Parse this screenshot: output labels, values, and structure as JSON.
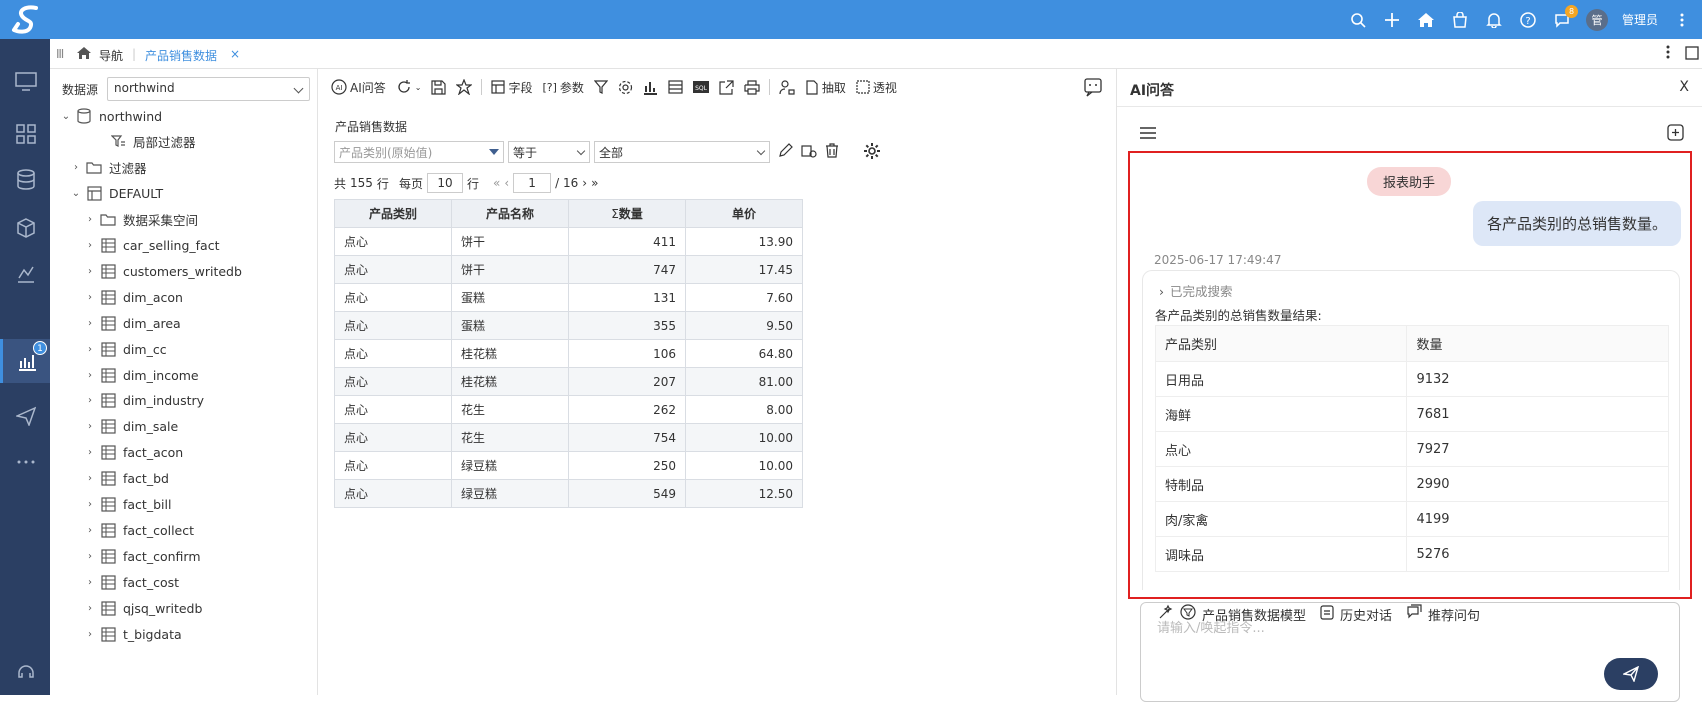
{
  "topbar": {
    "user_avatar": "管",
    "user_name": "管理员",
    "notify_badge": "8",
    "brand_color": "#3f8fdf"
  },
  "leftnav": {
    "badge": "1",
    "bottom_label": "帮助"
  },
  "tabs": {
    "nav_label": "导航",
    "active_tab": "产品销售数据",
    "close": "×"
  },
  "tree": {
    "datasource_label": "数据源",
    "datasource_value": "northwind",
    "nodes": [
      {
        "label": "northwind",
        "icon": "database-icon",
        "arrow": "⌄"
      },
      {
        "label": "局部过滤器",
        "icon": "filter-list-icon",
        "arrow": ""
      },
      {
        "label": "过滤器",
        "icon": "folder-icon",
        "arrow": "›"
      },
      {
        "label": "DEFAULT",
        "icon": "schema-icon",
        "arrow": "⌄"
      },
      {
        "label": "数据采集空间",
        "icon": "folder-icon",
        "arrow": "›"
      },
      {
        "label": "car_selling_fact",
        "icon": "table-icon",
        "arrow": "›"
      },
      {
        "label": "customers_writedb",
        "icon": "table-icon",
        "arrow": "›"
      },
      {
        "label": "dim_acon",
        "icon": "table-icon",
        "arrow": "›"
      },
      {
        "label": "dim_area",
        "icon": "table-icon",
        "arrow": "›"
      },
      {
        "label": "dim_cc",
        "icon": "table-icon",
        "arrow": "›"
      },
      {
        "label": "dim_income",
        "icon": "table-icon",
        "arrow": "›"
      },
      {
        "label": "dim_industry",
        "icon": "table-icon",
        "arrow": "›"
      },
      {
        "label": "dim_sale",
        "icon": "table-icon",
        "arrow": "›"
      },
      {
        "label": "fact_acon",
        "icon": "table-icon",
        "arrow": "›"
      },
      {
        "label": "fact_bd",
        "icon": "table-icon",
        "arrow": "›"
      },
      {
        "label": "fact_bill",
        "icon": "table-icon",
        "arrow": "›"
      },
      {
        "label": "fact_collect",
        "icon": "table-icon",
        "arrow": "›"
      },
      {
        "label": "fact_confirm",
        "icon": "table-icon",
        "arrow": "›"
      },
      {
        "label": "fact_cost",
        "icon": "table-icon",
        "arrow": "›"
      },
      {
        "label": "qjsq_writedb",
        "icon": "table-icon",
        "arrow": "›"
      },
      {
        "label": "t_bigdata",
        "icon": "table-icon",
        "arrow": "›"
      }
    ]
  },
  "toolbar": {
    "ai_label": "AI问答",
    "field_label": "字段",
    "param_label": "参数",
    "extract_label": "抽取",
    "pivot_label": "透视"
  },
  "report": {
    "title": "产品销售数据",
    "filter_field_placeholder": "产品类别(原始值)",
    "filter_op": "等于",
    "filter_value": "全部",
    "pager": {
      "total_prefix": "共",
      "total": "155",
      "total_suffix": "行",
      "per_page_label": "每页",
      "per_page": "10",
      "per_page_suffix": "行",
      "page": "1",
      "pages": "/ 16"
    },
    "columns": [
      "产品类别",
      "产品名称",
      "数量",
      "单价"
    ],
    "rows": [
      [
        "点心",
        "饼干",
        "411",
        "13.90"
      ],
      [
        "点心",
        "饼干",
        "747",
        "17.45"
      ],
      [
        "点心",
        "蛋糕",
        "131",
        "7.60"
      ],
      [
        "点心",
        "蛋糕",
        "355",
        "9.50"
      ],
      [
        "点心",
        "桂花糕",
        "106",
        "64.80"
      ],
      [
        "点心",
        "桂花糕",
        "207",
        "81.00"
      ],
      [
        "点心",
        "花生",
        "262",
        "8.00"
      ],
      [
        "点心",
        "花生",
        "754",
        "10.00"
      ],
      [
        "点心",
        "绿豆糕",
        "250",
        "10.00"
      ],
      [
        "点心",
        "绿豆糕",
        "549",
        "12.50"
      ]
    ]
  },
  "ai": {
    "title": "AI问答",
    "close": "X",
    "chip": "报表助手",
    "user_message": "各产品类别的总销售数量。",
    "timestamp": "2025-06-17 17:49:47",
    "search_done": "已完成搜索",
    "answer_title": "各产品类别的总销售数量结果:",
    "columns": [
      "产品类别",
      "数量"
    ],
    "rows": [
      [
        "日用品",
        "9132"
      ],
      [
        "海鲜",
        "7681"
      ],
      [
        "点心",
        "7927"
      ],
      [
        "特制品",
        "2990"
      ],
      [
        "肉/家禽",
        "4199"
      ],
      [
        "调味品",
        "5276"
      ]
    ],
    "model_label": "产品销售数据模型",
    "history_label": "历史对话",
    "recommend_label": "推荐问句",
    "input_placeholder": "请输入/唤起指令...",
    "highlight_color": "#e02020"
  }
}
